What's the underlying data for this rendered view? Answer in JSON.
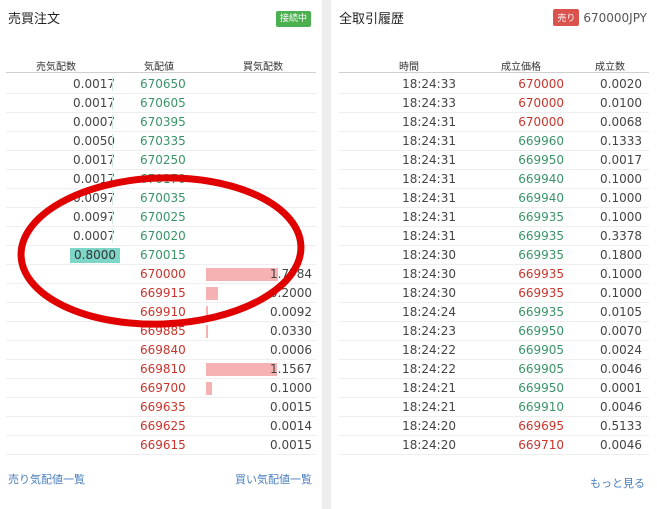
{
  "orderbook": {
    "title": "売買注文",
    "status_badge": "接続中",
    "headers": {
      "sell_size": "売気配数",
      "price": "気配値",
      "buy_size": "買気配数"
    },
    "asks": [
      {
        "size": "0.0017",
        "price": "670650"
      },
      {
        "size": "0.0017",
        "price": "670605"
      },
      {
        "size": "0.0007",
        "price": "670395"
      },
      {
        "size": "0.0050",
        "price": "670335"
      },
      {
        "size": "0.0017",
        "price": "670250"
      },
      {
        "size": "0.0017",
        "price": "670170"
      },
      {
        "size": "0.0097",
        "price": "670035"
      },
      {
        "size": "0.0097",
        "price": "670025"
      },
      {
        "size": "0.0007",
        "price": "670020"
      },
      {
        "size": "0.8000",
        "price": "670015"
      }
    ],
    "bids": [
      {
        "price": "670000",
        "size": "1.7784",
        "bar_fraction": 1.0
      },
      {
        "price": "669915",
        "size": "0.2000",
        "bar_fraction": 0.16
      },
      {
        "price": "669910",
        "size": "0.0092",
        "bar_fraction": 0.01
      },
      {
        "price": "669885",
        "size": "0.0330",
        "bar_fraction": 0.02
      },
      {
        "price": "669840",
        "size": "0.0006",
        "bar_fraction": 0.0
      },
      {
        "price": "669810",
        "size": "1.1567",
        "bar_fraction": 0.99
      },
      {
        "price": "669700",
        "size": "0.1000",
        "bar_fraction": 0.08
      },
      {
        "price": "669635",
        "size": "0.0015",
        "bar_fraction": 0.0
      },
      {
        "price": "669625",
        "size": "0.0014",
        "bar_fraction": 0.0
      },
      {
        "price": "669615",
        "size": "0.0015",
        "bar_fraction": 0.0
      }
    ],
    "footer": {
      "sell_link": "売り気配値一覧",
      "buy_link": "買い気配値一覧"
    }
  },
  "trades": {
    "title": "全取引履歴",
    "last_side_badge": "売り",
    "last_price": "670000JPY",
    "headers": {
      "time": "時間",
      "price": "成立価格",
      "size": "成立数"
    },
    "rows": [
      {
        "time": "18:24:33",
        "price": "670000",
        "size": "0.0020",
        "dir": "down"
      },
      {
        "time": "18:24:33",
        "price": "670000",
        "size": "0.0100",
        "dir": "down"
      },
      {
        "time": "18:24:31",
        "price": "670000",
        "size": "0.0068",
        "dir": "down"
      },
      {
        "time": "18:24:31",
        "price": "669960",
        "size": "0.1333",
        "dir": "up"
      },
      {
        "time": "18:24:31",
        "price": "669950",
        "size": "0.0017",
        "dir": "up"
      },
      {
        "time": "18:24:31",
        "price": "669940",
        "size": "0.1000",
        "dir": "up"
      },
      {
        "time": "18:24:31",
        "price": "669940",
        "size": "0.1000",
        "dir": "up"
      },
      {
        "time": "18:24:31",
        "price": "669935",
        "size": "0.1000",
        "dir": "up"
      },
      {
        "time": "18:24:31",
        "price": "669935",
        "size": "0.3378",
        "dir": "up"
      },
      {
        "time": "18:24:30",
        "price": "669935",
        "size": "0.1800",
        "dir": "up"
      },
      {
        "time": "18:24:30",
        "price": "669935",
        "size": "0.1000",
        "dir": "down"
      },
      {
        "time": "18:24:30",
        "price": "669935",
        "size": "0.1000",
        "dir": "down"
      },
      {
        "time": "18:24:24",
        "price": "669935",
        "size": "0.0105",
        "dir": "up"
      },
      {
        "time": "18:24:23",
        "price": "669950",
        "size": "0.0070",
        "dir": "up"
      },
      {
        "time": "18:24:22",
        "price": "669905",
        "size": "0.0024",
        "dir": "up"
      },
      {
        "time": "18:24:22",
        "price": "669905",
        "size": "0.0046",
        "dir": "up"
      },
      {
        "time": "18:24:21",
        "price": "669950",
        "size": "0.0001",
        "dir": "up"
      },
      {
        "time": "18:24:21",
        "price": "669910",
        "size": "0.0046",
        "dir": "up"
      },
      {
        "time": "18:24:20",
        "price": "669695",
        "size": "0.5133",
        "dir": "down"
      },
      {
        "time": "18:24:20",
        "price": "669710",
        "size": "0.0046",
        "dir": "down"
      }
    ],
    "more_link": "もっと見る"
  },
  "colors": {
    "ask_price": "#3a9468",
    "bid_price": "#c8352d",
    "bid_bar": "#f6b2b2",
    "highlight": "#7dd6c8",
    "annotation": "#e00000"
  }
}
